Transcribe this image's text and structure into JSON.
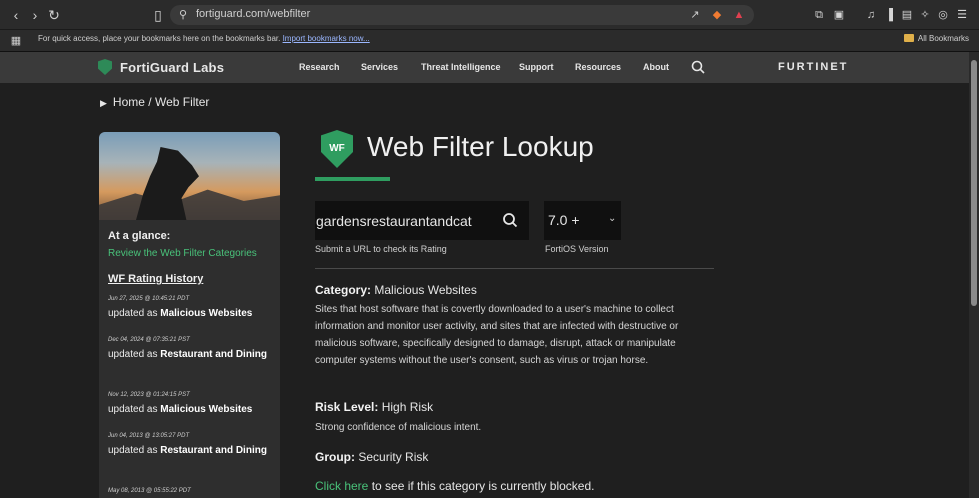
{
  "browser": {
    "url": "fortiguard.com/webfilter",
    "bookmarks_hint": "For quick access, place your bookmarks here on the bookmarks bar.",
    "import_link": "Import bookmarks now...",
    "all_bookmarks": "All Bookmarks"
  },
  "site": {
    "brand": "FortiGuard Labs",
    "nav": [
      "Research",
      "Services",
      "Threat Intelligence",
      "Support",
      "Resources",
      "About"
    ],
    "logo_text": "F̶RTINET"
  },
  "breadcrumb": {
    "home": "Home",
    "separator": "/",
    "current": "Web Filter"
  },
  "sidebar": {
    "glance_title": "At a glance:",
    "review_link": "Review the Web Filter Categories",
    "history_title": "WF Rating History",
    "entries": [
      {
        "date": "Jun 27, 2025 @ 10:45:21 PDT",
        "prefix": "updated as ",
        "category": "Malicious Websites"
      },
      {
        "date": "Dec 04, 2024 @ 07:35:21 PST",
        "prefix": "updated as ",
        "category": "Restaurant and Dining"
      },
      {
        "date": "Nov 12, 2023 @ 01:24:15 PST",
        "prefix": "updated as ",
        "category": "Malicious Websites"
      },
      {
        "date": "Jun 04, 2013 @ 13:05:27 PDT",
        "prefix": "updated as ",
        "category": "Restaurant and Dining"
      },
      {
        "date": "May 08, 2013 @ 05:55:22 PDT",
        "prefix": "",
        "category": ""
      }
    ]
  },
  "main": {
    "badge": "WF",
    "title": "Web Filter Lookup",
    "search_value": "gardensrestaurantandcat",
    "search_help": "Submit a URL to check its Rating",
    "version_value": "7.0 +",
    "version_label": "FortiOS Version",
    "category_label": "Category:",
    "category_value": "Malicious Websites",
    "category_desc": "Sites that host software that is covertly downloaded to a user's machine to collect information and monitor user activity, and sites that are infected with destructive or malicious software, specifically designed to damage, disrupt, attack or manipulate computer systems without the user's consent, such as virus or trojan horse.",
    "risk_label": "Risk Level:",
    "risk_value": "High Risk",
    "risk_desc": "Strong confidence of malicious intent.",
    "group_label": "Group:",
    "group_value": "Security Risk",
    "blocked_link": "Click here",
    "blocked_text": " to see if this category is currently blocked."
  },
  "colors": {
    "accent_green": "#2f9d60",
    "link_green": "#49c27a",
    "bg": "#1f1f1f"
  }
}
